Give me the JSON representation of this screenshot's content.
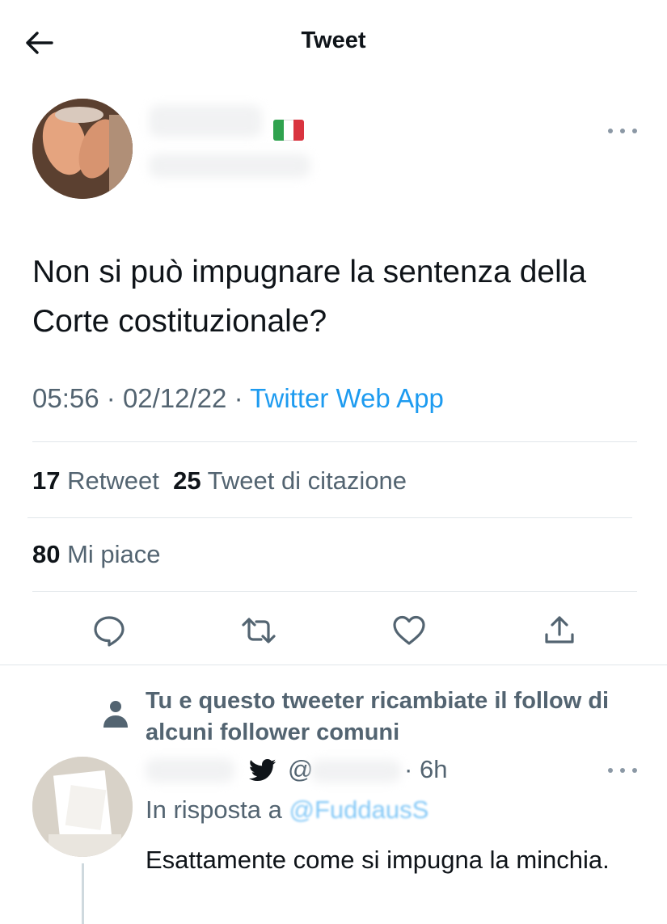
{
  "header": {
    "title": "Tweet"
  },
  "tweet": {
    "text": "Non si può impugnare la sentenza della Corte costituzionale?",
    "time": "05:56",
    "date": "02/12/22",
    "separator": "·",
    "source": "Twitter Web App",
    "flag_icon": "italian-flag-emoji"
  },
  "stats": {
    "retweets_count": "17",
    "retweets_label": "Retweet",
    "quotes_count": "25",
    "quotes_label": "Tweet di citazione",
    "likes_count": "80",
    "likes_label": "Mi piace"
  },
  "actions": [
    "reply-icon",
    "retweet-icon",
    "like-icon",
    "share-icon"
  ],
  "notice": {
    "text": "Tu e questo tweeter ricambiate il follow di alcuni follower comuni"
  },
  "reply": {
    "time": "6h",
    "at": "@",
    "reply_to_label": "In risposta a",
    "reply_to_handle": "@FuddausS",
    "text": "Esattamente come si impugna la minchia."
  },
  "colors": {
    "accent": "#1d9bf0",
    "text": "#0f1419",
    "muted": "#536471",
    "divider": "#e1e6ea"
  }
}
